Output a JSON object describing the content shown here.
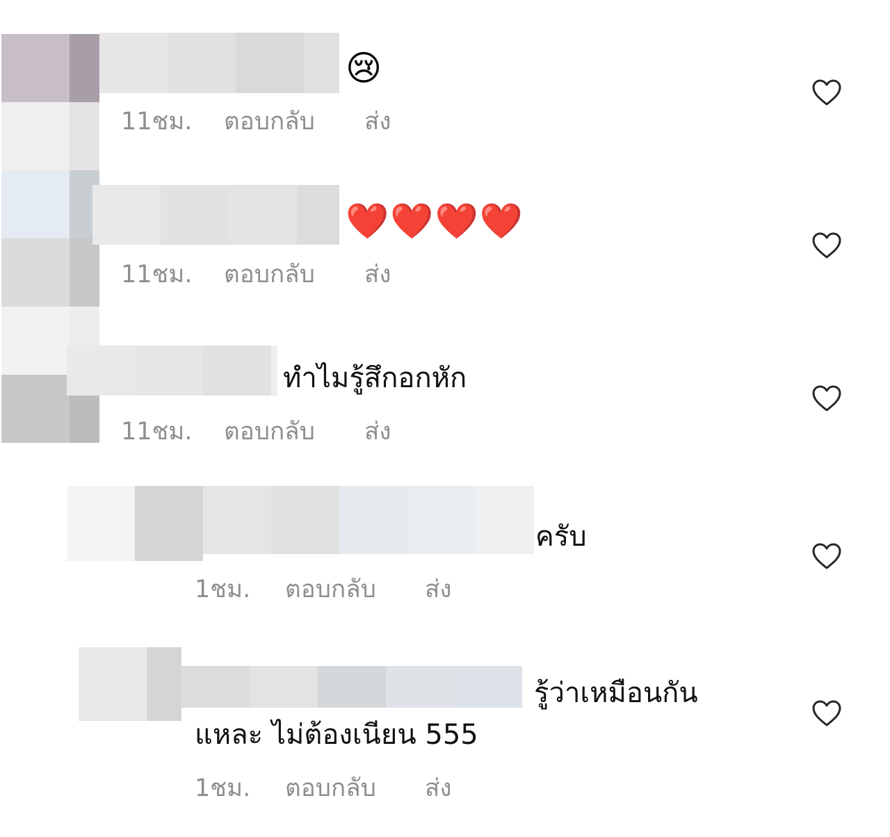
{
  "icons": {
    "like": "heart-outline-icon"
  },
  "comments": [
    {
      "body_text": "",
      "emoji": "😢",
      "time": "11ชม.",
      "reply_label": "ตอบกลับ",
      "send_label": "ส่ง"
    },
    {
      "body_text": "",
      "emoji": "❤️❤️❤️❤️",
      "time": "11ชม.",
      "reply_label": "ตอบกลับ",
      "send_label": "ส่ง"
    },
    {
      "body_text": "ทำไมรู้สึกอกหัก",
      "emoji": "",
      "time": "11ชม.",
      "reply_label": "ตอบกลับ",
      "send_label": "ส่ง"
    },
    {
      "body_text": "ครับ",
      "emoji": "",
      "time": "1ชม.",
      "reply_label": "ตอบกลับ",
      "send_label": "ส่ง"
    },
    {
      "body_text": "รู้ว่าเหมือนกัน",
      "body_text_line2": "แหละ ไม่ต้องเนียน 555",
      "emoji": "",
      "time": "1ชม.",
      "reply_label": "ตอบกลับ",
      "send_label": "ส่ง"
    }
  ]
}
